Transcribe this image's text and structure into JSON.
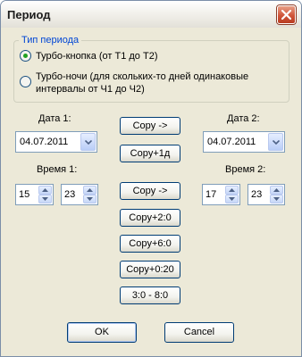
{
  "window": {
    "title": "Период"
  },
  "period_group": {
    "label": "Тип периода",
    "options": [
      {
        "label": "Турбо-кнопка (от Т1 до Т2)",
        "selected": true
      },
      {
        "label_line1": "Турбо-ночи (для скольких-то дней одинаковые",
        "label_line2": "интервалы от Ч1 до Ч2)",
        "selected": false
      }
    ]
  },
  "date1": {
    "label": "Дата 1:",
    "value": "04.07.2011"
  },
  "date2": {
    "label": "Дата 2:",
    "value": "04.07.2011"
  },
  "time1": {
    "label": "Время 1:",
    "hours": "15",
    "minutes": "23"
  },
  "time2": {
    "label": "Время 2:",
    "hours": "17",
    "minutes": "23"
  },
  "buttons": {
    "copy_date": "Copy ->",
    "copy_plus_day": "Copy+1д",
    "copy_time": "Copy ->",
    "copy_plus_2": "Copy+2:0",
    "copy_plus_6": "Copy+6:0",
    "copy_plus_020": "Copy+0:20",
    "range_3_8": "3:0 - 8:0",
    "ok": "OK",
    "cancel": "Cancel"
  },
  "colors": {
    "group_label": "#0046d5",
    "radio_dot": "#21a121",
    "close_button": "#d0553a"
  },
  "icons": {
    "close": "close-icon",
    "combo_arrow": "chevron-down-icon",
    "spin_up": "arrow-up-icon",
    "spin_down": "arrow-down-icon"
  }
}
